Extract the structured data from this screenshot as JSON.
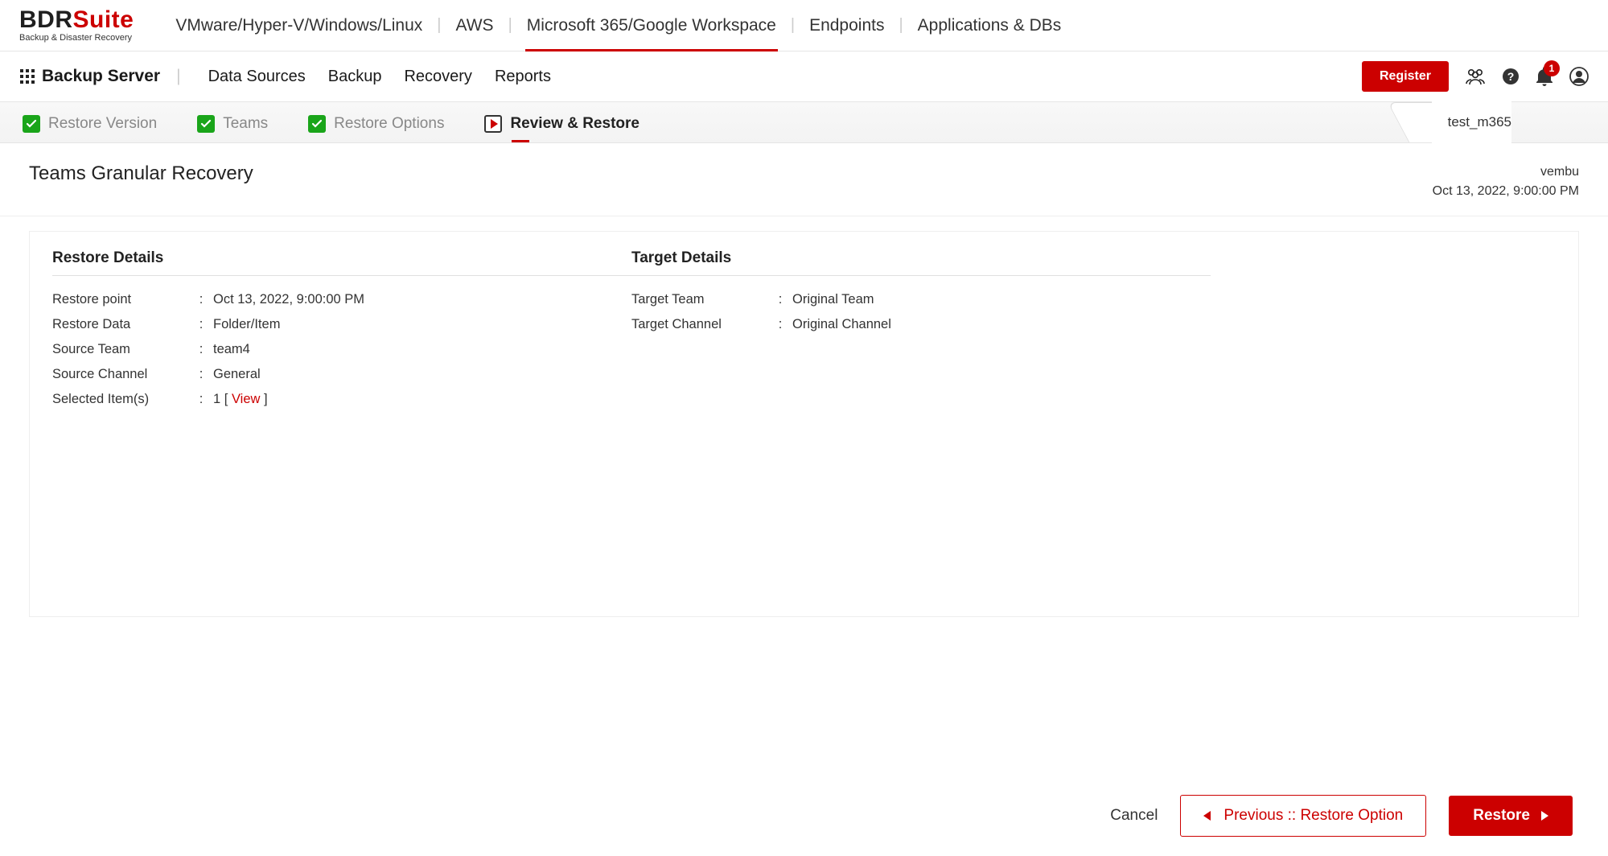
{
  "logo": {
    "prefix": "BDR",
    "suffix": "Suite",
    "tagline": "Backup & Disaster Recovery"
  },
  "topnav": {
    "items": [
      "VMware/Hyper-V/Windows/Linux",
      "AWS",
      "Microsoft 365/Google Workspace",
      "Endpoints",
      "Applications & DBs"
    ],
    "active_index": 2
  },
  "secondnav": {
    "server_label": "Backup Server",
    "links": [
      "Data Sources",
      "Backup",
      "Recovery",
      "Reports"
    ],
    "register_label": "Register",
    "notification_count": "1"
  },
  "wizard": {
    "steps": [
      {
        "label": "Restore Version",
        "done": true
      },
      {
        "label": "Teams",
        "done": true
      },
      {
        "label": "Restore Options",
        "done": true
      },
      {
        "label": "Review & Restore",
        "active": true
      }
    ],
    "context_label": "test_m365"
  },
  "page": {
    "title": "Teams Granular Recovery",
    "meta_user": "vembu",
    "meta_time": "Oct 13, 2022, 9:00:00 PM"
  },
  "restore_details": {
    "title": "Restore Details",
    "rows": [
      {
        "label": "Restore point",
        "value": "Oct 13, 2022, 9:00:00 PM"
      },
      {
        "label": "Restore Data",
        "value": "Folder/Item"
      },
      {
        "label": "Source Team",
        "value": "team4"
      },
      {
        "label": "Source Channel",
        "value": "General"
      }
    ],
    "selected_label": "Selected Item(s)",
    "selected_count": "1",
    "view_label": "View"
  },
  "target_details": {
    "title": "Target Details",
    "rows": [
      {
        "label": "Target Team",
        "value": "Original Team"
      },
      {
        "label": "Target Channel",
        "value": "Original Channel"
      }
    ]
  },
  "footer": {
    "cancel": "Cancel",
    "previous": "Previous :: Restore Option",
    "restore": "Restore"
  }
}
